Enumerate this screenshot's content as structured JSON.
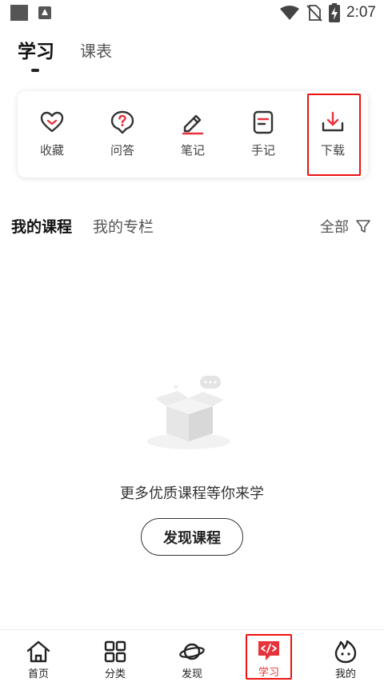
{
  "status_bar": {
    "time": "2:07",
    "icons": [
      "gallery-icon",
      "app-icon",
      "wifi-icon",
      "no-sim-icon",
      "battery-charging-icon"
    ]
  },
  "top_tabs": [
    {
      "label": "学习",
      "active": true
    },
    {
      "label": "课表",
      "active": false
    }
  ],
  "tools": [
    {
      "label": "收藏",
      "icon": "heart-icon"
    },
    {
      "label": "问答",
      "icon": "question-bubble-icon"
    },
    {
      "label": "笔记",
      "icon": "pencil-icon"
    },
    {
      "label": "手记",
      "icon": "note-icon"
    },
    {
      "label": "下载",
      "icon": "download-icon",
      "highlighted": true
    }
  ],
  "course_tabs": {
    "active": "我的课程",
    "inactive": "我的专栏",
    "filter_label": "全部",
    "filter_icon": "filter-icon"
  },
  "empty_state": {
    "illustration": "empty-box-illustration",
    "message": "更多优质课程等你来学",
    "button_label": "发现课程"
  },
  "bottom_nav": [
    {
      "label": "首页",
      "icon": "home-icon",
      "active": false
    },
    {
      "label": "分类",
      "icon": "grid-icon",
      "active": false
    },
    {
      "label": "发现",
      "icon": "planet-icon",
      "active": false
    },
    {
      "label": "学习",
      "icon": "code-icon",
      "active": true,
      "highlighted": true
    },
    {
      "label": "我的",
      "icon": "flame-face-icon",
      "active": false
    }
  ],
  "colors": {
    "accent": "#e8323c",
    "highlight_border": "#e11111",
    "text_primary": "#111111",
    "text_secondary": "#555555"
  }
}
